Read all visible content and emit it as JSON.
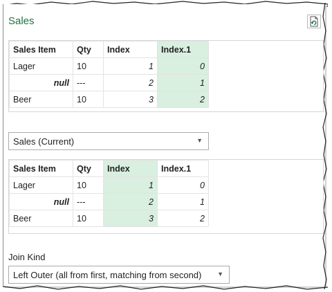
{
  "title": "Sales",
  "columns": [
    "Sales Item",
    "Qty",
    "Index",
    "Index.1"
  ],
  "top_table": {
    "rows": [
      [
        "Lager",
        "10",
        "1",
        "0"
      ],
      [
        "null",
        "---",
        "2",
        "1"
      ],
      [
        "Beer",
        "10",
        "3",
        "2"
      ]
    ]
  },
  "second_table_dropdown": "Sales (Current)",
  "bottom_table": {
    "rows": [
      [
        "Lager",
        "10",
        "1",
        "0"
      ],
      [
        "null",
        "---",
        "2",
        "1"
      ],
      [
        "Beer",
        "10",
        "3",
        "2"
      ]
    ]
  },
  "join_kind": {
    "label": "Join Kind",
    "value": "Left Outer (all from first, matching from second)"
  },
  "colors": {
    "title": "#217346",
    "highlight": "#d9efe0"
  },
  "icons": {
    "refresh": "refresh-document-icon",
    "dropdown": "chevron-down-icon"
  }
}
